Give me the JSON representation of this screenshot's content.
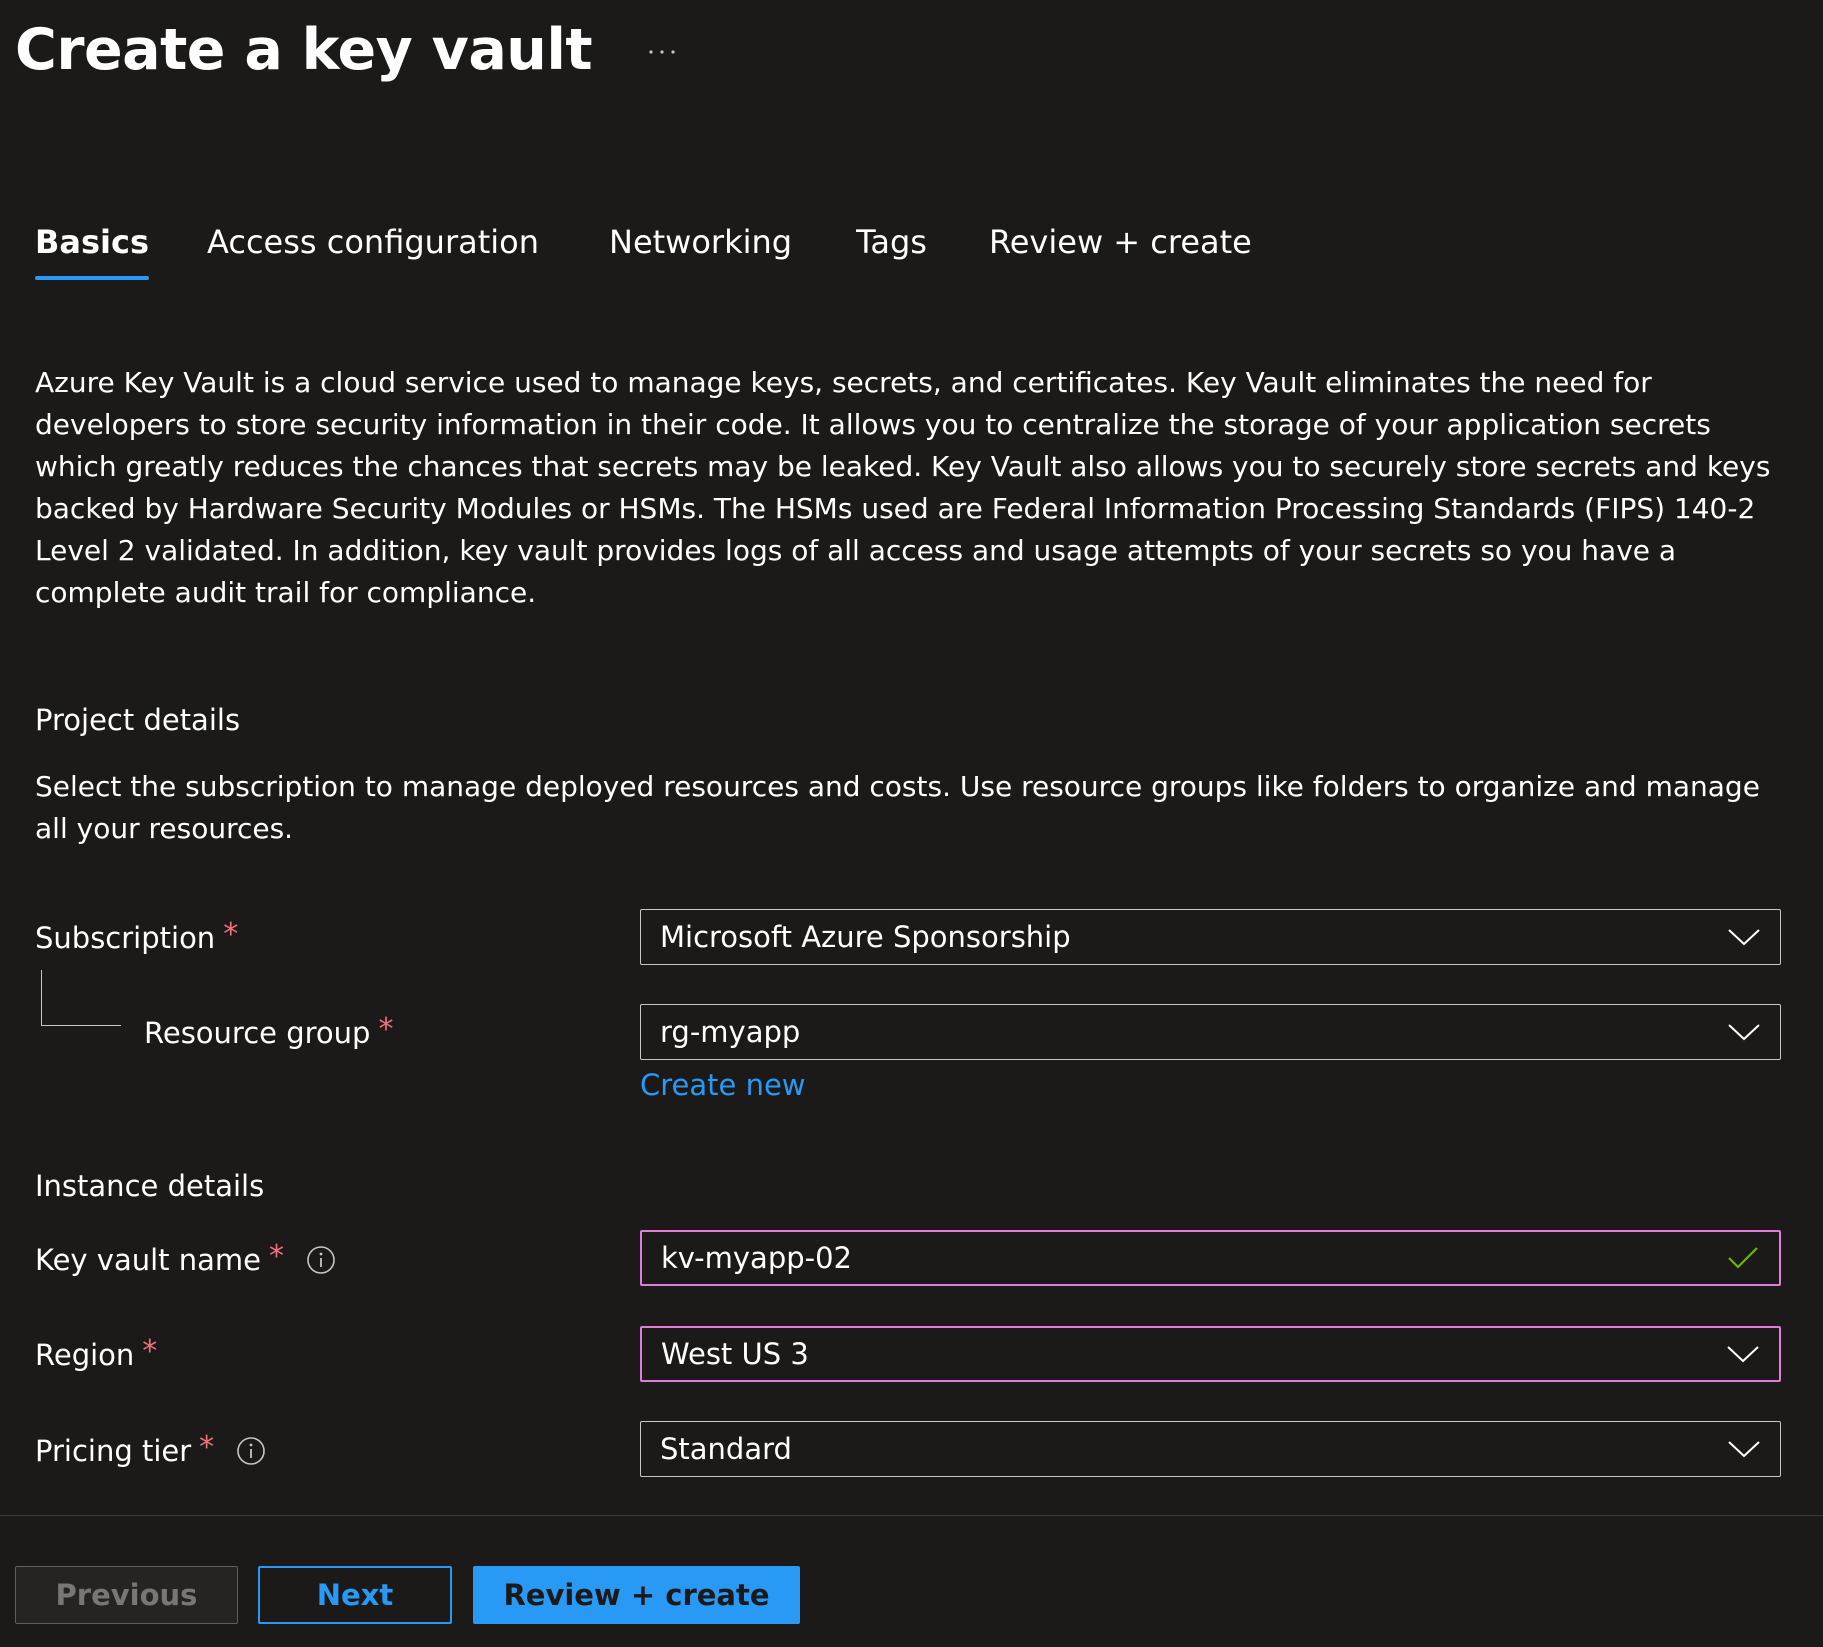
{
  "header": {
    "title": "Create a key vault",
    "more_icon": "ellipsis-icon"
  },
  "tabs": [
    {
      "label": "Basics",
      "active": true
    },
    {
      "label": "Access configuration",
      "active": false
    },
    {
      "label": "Networking",
      "active": false
    },
    {
      "label": "Tags",
      "active": false
    },
    {
      "label": "Review + create",
      "active": false
    }
  ],
  "description": "Azure Key Vault is a cloud service used to manage keys, secrets, and certificates. Key Vault eliminates the need for developers to store security information in their code. It allows you to centralize the storage of your application secrets which greatly reduces the chances that secrets may be leaked. Key Vault also allows you to securely store secrets and keys backed by Hardware Security Modules or HSMs. The HSMs used are Federal Information Processing Standards (FIPS) 140-2 Level 2 validated. In addition, key vault provides logs of all access and usage attempts of your secrets so you have a complete audit trail for compliance.",
  "project_details": {
    "heading": "Project details",
    "description": "Select the subscription to manage deployed resources and costs. Use resource groups like folders to organize and manage all your resources.",
    "subscription": {
      "label": "Subscription",
      "required_mark": "*",
      "value": "Microsoft Azure Sponsorship"
    },
    "resource_group": {
      "label": "Resource group",
      "required_mark": "*",
      "value": "rg-myapp",
      "create_new_label": "Create new"
    }
  },
  "instance_details": {
    "heading": "Instance details",
    "key_vault_name": {
      "label": "Key vault name",
      "required_mark": "*",
      "value": "kv-myapp-02",
      "validation_icon": "checkmark-icon",
      "has_info": true
    },
    "region": {
      "label": "Region",
      "required_mark": "*",
      "value": "West US 3"
    },
    "pricing_tier": {
      "label": "Pricing tier",
      "required_mark": "*",
      "value": "Standard",
      "has_info": true
    }
  },
  "footer": {
    "previous_label": "Previous",
    "next_label": "Next",
    "review_create_label": "Review + create"
  },
  "colors": {
    "background": "#1b1a19",
    "accent": "#2899f5",
    "required": "#f1707b",
    "focus_border": "#e37ae0",
    "valid": "#6bb700"
  }
}
